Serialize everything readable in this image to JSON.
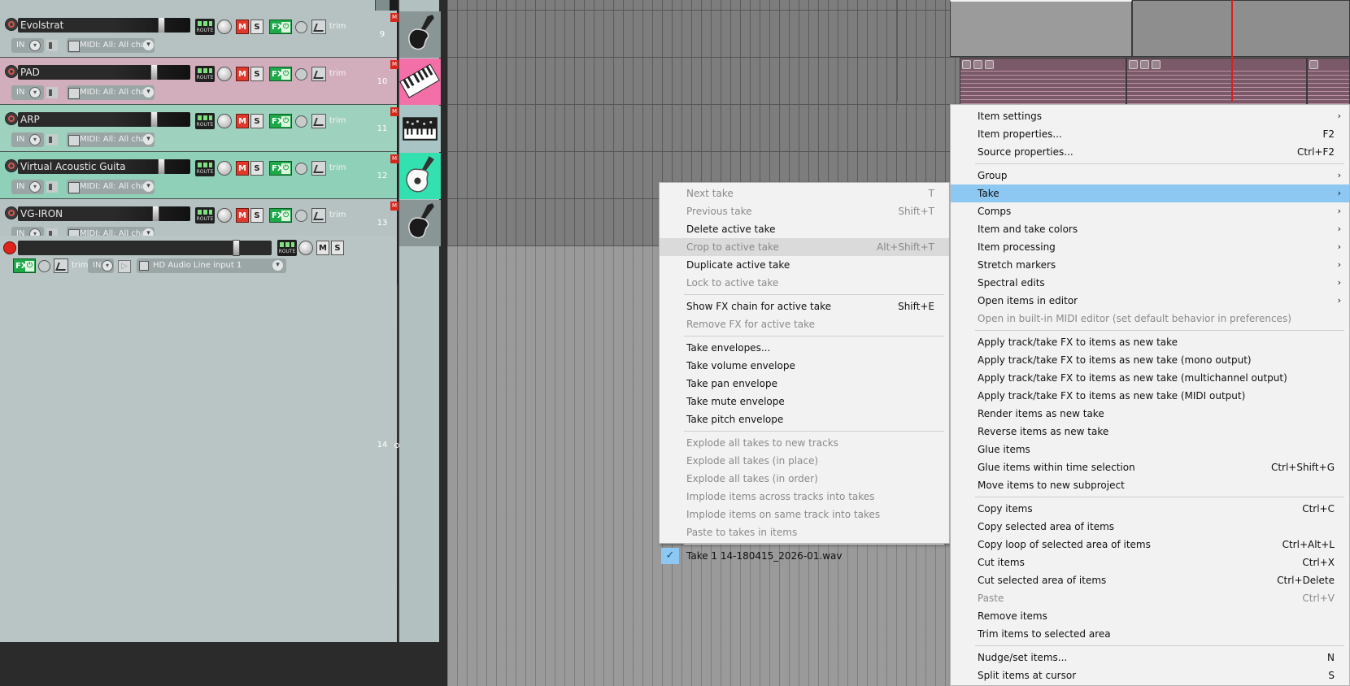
{
  "tracks": [
    {
      "num": "9",
      "name": "Evolstrat",
      "color": "#b6c2c2",
      "icon": "electric-guitar-icon",
      "vol_fader": 0.6
    },
    {
      "num": "10",
      "name": "PAD",
      "color": "#d2aebd",
      "icon": "keyboard-piano-icon",
      "vol_fader": 0.5
    },
    {
      "num": "11",
      "name": "ARP",
      "color": "#9fd1bf",
      "icon": "synthesizer-icon",
      "vol_fader": 0.5
    },
    {
      "num": "12",
      "name": "Virtual Acoustic Guita",
      "color": "#8fd0b8",
      "icon": "acoustic-guitar-icon",
      "vol_fader": 0.6
    },
    {
      "num": "13",
      "name": "VG-IRON",
      "color": "#b6c2c2",
      "icon": "electric-guitar-icon",
      "vol_fader": 0.52
    }
  ],
  "track_labels": {
    "route": "ROUTE",
    "mute": "M",
    "solo": "S",
    "fx": "FX",
    "trim": "trim",
    "in": "IN",
    "midi_input": "MIDI: All: All char"
  },
  "track14": {
    "num": "14",
    "input": "HD Audio Line input 1"
  },
  "take_menu": {
    "items": [
      {
        "label": "Next take",
        "shortcut": "T",
        "disabled": true
      },
      {
        "label": "Previous take",
        "shortcut": "Shift+T",
        "disabled": true
      },
      {
        "label": "Delete active take",
        "shortcut": "",
        "disabled": false
      },
      {
        "label": "Crop to active take",
        "shortcut": "Alt+Shift+T",
        "disabled": true,
        "hover": true
      },
      {
        "label": "Duplicate active take",
        "shortcut": "",
        "disabled": false
      },
      {
        "label": "Lock to active take",
        "shortcut": "",
        "disabled": true
      },
      {
        "sep": true
      },
      {
        "label": "Show FX chain for active take",
        "shortcut": "Shift+E",
        "disabled": false
      },
      {
        "label": "Remove FX for active take",
        "shortcut": "",
        "disabled": true
      },
      {
        "sep": true
      },
      {
        "label": "Take envelopes...",
        "shortcut": "",
        "disabled": false
      },
      {
        "label": "Take volume envelope",
        "shortcut": "",
        "disabled": false
      },
      {
        "label": "Take pan envelope",
        "shortcut": "",
        "disabled": false
      },
      {
        "label": "Take mute envelope",
        "shortcut": "",
        "disabled": false
      },
      {
        "label": "Take pitch envelope",
        "shortcut": "",
        "disabled": false
      },
      {
        "sep": true
      },
      {
        "label": "Explode all takes to new tracks",
        "shortcut": "",
        "disabled": true
      },
      {
        "label": "Explode all takes (in place)",
        "shortcut": "",
        "disabled": true
      },
      {
        "label": "Explode all takes (in order)",
        "shortcut": "",
        "disabled": true
      },
      {
        "label": "Implode items across tracks into takes",
        "shortcut": "",
        "disabled": true
      },
      {
        "label": "Implode items on same track into takes",
        "shortcut": "",
        "disabled": true
      },
      {
        "label": "Paste to takes in items",
        "shortcut": "",
        "disabled": true
      },
      {
        "sep": true
      },
      {
        "label": "Take 1 14-180415_2026-01.wav",
        "shortcut": "",
        "disabled": false,
        "checked": true
      }
    ]
  },
  "item_menu": {
    "items": [
      {
        "label": "Item settings",
        "shortcut": "",
        "submenu": true
      },
      {
        "label": "Item properties...",
        "shortcut": "F2"
      },
      {
        "label": "Source properties...",
        "shortcut": "Ctrl+F2"
      },
      {
        "sep": true
      },
      {
        "label": "Group",
        "shortcut": "",
        "submenu": true
      },
      {
        "label": "Take",
        "shortcut": "",
        "submenu": true,
        "highlight": true
      },
      {
        "label": "Comps",
        "shortcut": "",
        "submenu": true
      },
      {
        "label": "Item and take colors",
        "shortcut": "",
        "submenu": true
      },
      {
        "label": "Item processing",
        "shortcut": "",
        "submenu": true
      },
      {
        "label": "Stretch markers",
        "shortcut": "",
        "submenu": true
      },
      {
        "label": "Spectral edits",
        "shortcut": "",
        "submenu": true
      },
      {
        "label": "Open items in editor",
        "shortcut": "",
        "submenu": true
      },
      {
        "label": "Open in built-in MIDI editor (set default behavior in preferences)",
        "shortcut": "",
        "disabled": true
      },
      {
        "sep": true
      },
      {
        "label": "Apply track/take FX to items as new take",
        "shortcut": ""
      },
      {
        "label": "Apply track/take FX to items as new take (mono output)",
        "shortcut": ""
      },
      {
        "label": "Apply track/take FX to items as new take (multichannel output)",
        "shortcut": ""
      },
      {
        "label": "Apply track/take FX to items as new take (MIDI output)",
        "shortcut": ""
      },
      {
        "label": "Render items as new take",
        "shortcut": ""
      },
      {
        "label": "Reverse items as new take",
        "shortcut": ""
      },
      {
        "label": "Glue items",
        "shortcut": ""
      },
      {
        "label": "Glue items within time selection",
        "shortcut": "Ctrl+Shift+G"
      },
      {
        "label": "Move items to new subproject",
        "shortcut": ""
      },
      {
        "sep": true
      },
      {
        "label": "Copy items",
        "shortcut": "Ctrl+C"
      },
      {
        "label": "Copy selected area of items",
        "shortcut": ""
      },
      {
        "label": "Copy loop of selected area of items",
        "shortcut": "Ctrl+Alt+L"
      },
      {
        "label": "Cut items",
        "shortcut": "Ctrl+X"
      },
      {
        "label": "Cut selected area of items",
        "shortcut": "Ctrl+Delete"
      },
      {
        "label": "Paste",
        "shortcut": "Ctrl+V",
        "disabled": true
      },
      {
        "label": "Remove items",
        "shortcut": ""
      },
      {
        "label": "Trim items to selected area",
        "shortcut": ""
      },
      {
        "sep": true
      },
      {
        "label": "Nudge/set items...",
        "shortcut": "N"
      },
      {
        "label": "Split items at cursor",
        "shortcut": "S"
      }
    ]
  },
  "colors": {
    "menu_highlight": "#8cc8f2",
    "menu_bg": "#f2f2f2",
    "mute_red": "#e0392b",
    "fx_green": "#1ea84a"
  }
}
